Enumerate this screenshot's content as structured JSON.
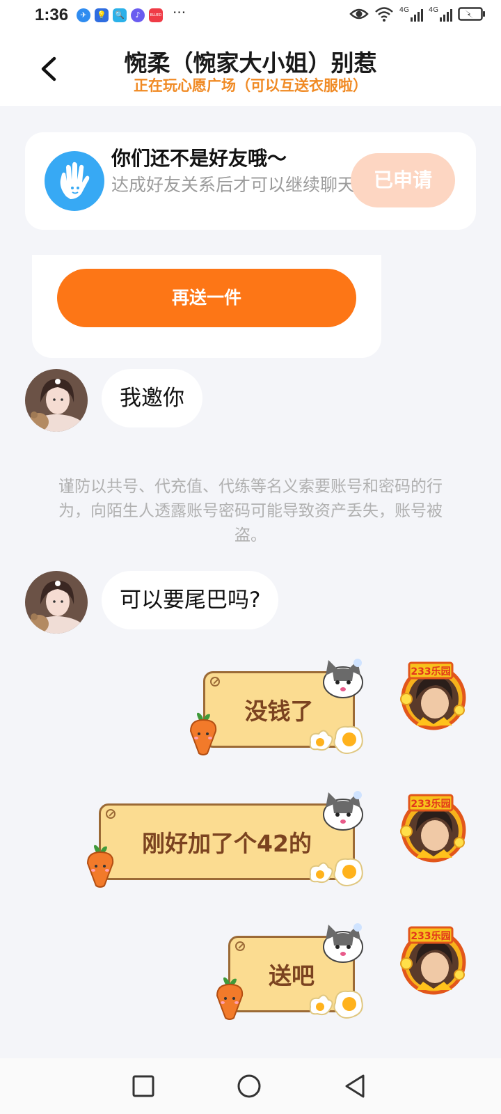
{
  "status_bar": {
    "time": "1:36",
    "apps": [
      "kakao-icon",
      "bulb-icon",
      "search-app-icon",
      "music-icon",
      "app-red-icon"
    ],
    "app_red_label": "BLUED",
    "network_1": "4G",
    "network_2": "4G",
    "battery_state": "charging",
    "colors": {
      "app_blue": "#2f8cf0",
      "app_red": "#ef3b46"
    }
  },
  "header": {
    "title": "惋柔（惋家大小姐）别惹",
    "subtitle": "正在玩心愿广场（可以互送衣服啦）"
  },
  "friend_notice": {
    "icon": "hand-wave-icon",
    "title": "你们还不是好友哦～",
    "description": "达成好友关系后才可以继续聊天",
    "button_label": "已申请",
    "colors": {
      "icon_bg": "#37a9f4",
      "button_bg": "#fdd6c2"
    }
  },
  "gift_card": {
    "button_label": "再送一件",
    "colors": {
      "button_bg": "#fd7616"
    }
  },
  "warning_text": "谨防以共号、代充值、代练等名义索要账号和密码的行为，向陌生人透露账号密码可能导致资产丢失，账号被盗。",
  "messages": [
    {
      "side": "left",
      "text": "我邀你"
    },
    {
      "side": "left",
      "text": "可以要尾巴吗?"
    },
    {
      "side": "right",
      "text": "没钱了"
    },
    {
      "side": "right",
      "text": "刚好加了个42的"
    },
    {
      "side": "right",
      "text": "送吧"
    }
  ],
  "avatar_right_badge": "233乐园",
  "colors": {
    "page_bg": "#f4f5f9",
    "accent_orange": "#f08a24",
    "scroll_bubble": "#fbdc91",
    "scroll_text": "#7b4320"
  },
  "nav_bar": {
    "buttons": [
      "recent-apps-icon",
      "home-icon",
      "back-icon"
    ]
  }
}
